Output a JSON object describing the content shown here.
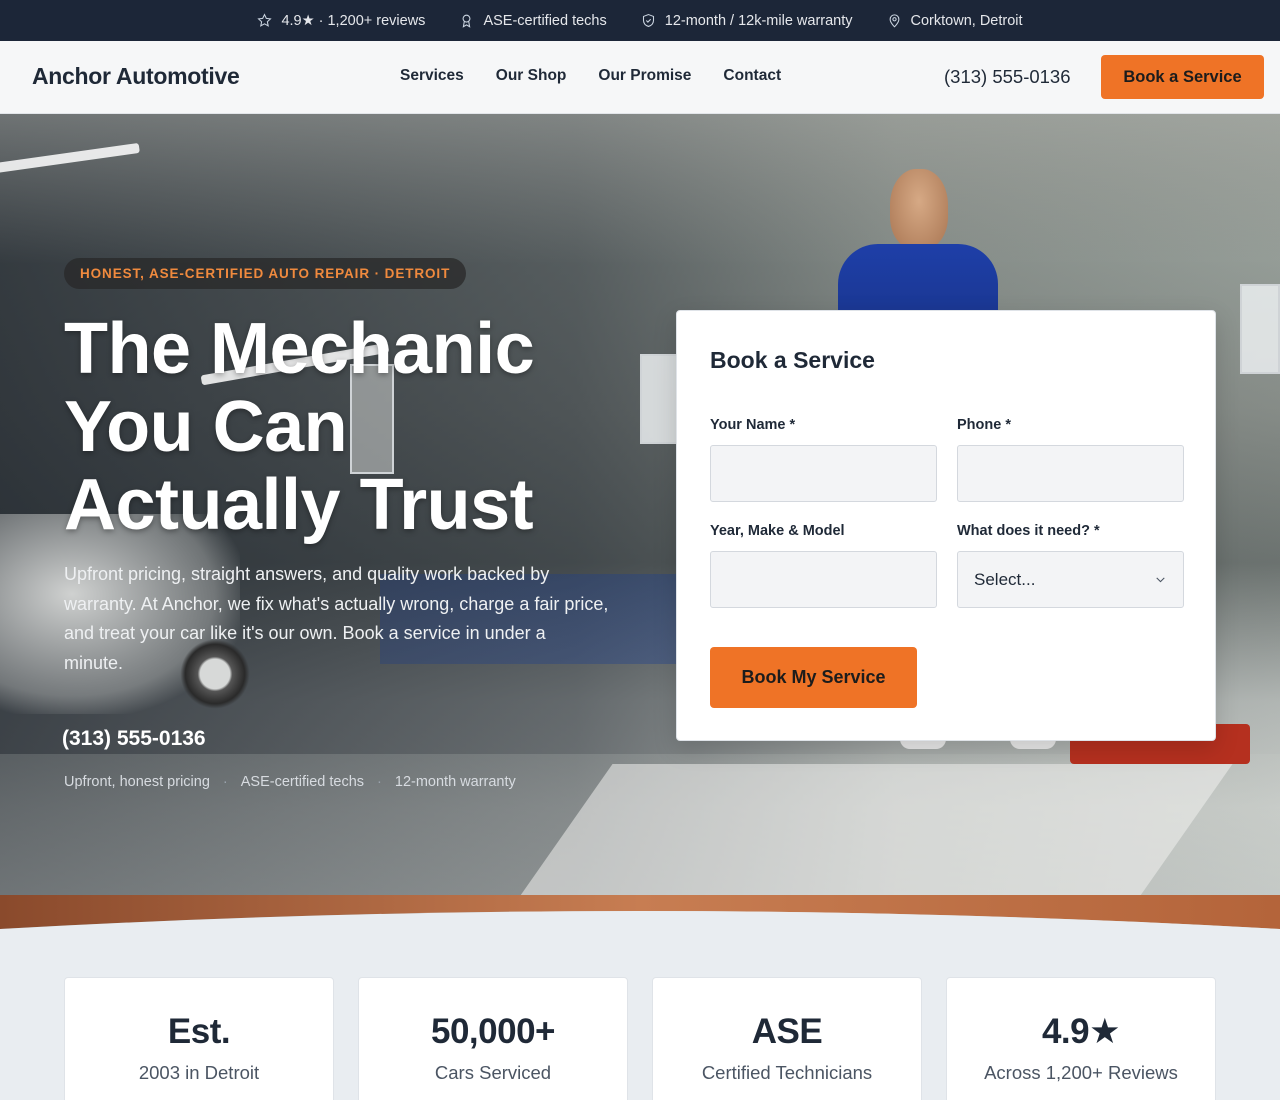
{
  "topbar": {
    "items": [
      {
        "icon": "star-icon",
        "text": "4.9★ · 1,200+ reviews"
      },
      {
        "icon": "award-icon",
        "text": "ASE-certified techs"
      },
      {
        "icon": "shield-icon",
        "text": "12-month / 12k-mile warranty"
      },
      {
        "icon": "map-pin-icon",
        "text": "Corktown, Detroit"
      }
    ]
  },
  "nav": {
    "brand": "Anchor Automotive",
    "links": [
      "Services",
      "Our Shop",
      "Our Promise",
      "Contact"
    ],
    "phone": "(313) 555-0136",
    "cta": "Book a Service"
  },
  "hero": {
    "badge": "HONEST, ASE-CERTIFIED AUTO REPAIR · DETROIT",
    "headline": "The Mechanic You Can Actually Trust",
    "lede": "Upfront pricing, straight answers, and quality work backed by warranty. At Anchor, we fix what's actually wrong, charge a fair price, and treat your car like it's our own. Book a service in under a minute.",
    "phone": "(313) 555-0136",
    "assurances": [
      "Upfront, honest pricing",
      "ASE-certified techs",
      "12-month warranty"
    ]
  },
  "form": {
    "title": "Book a Service",
    "name_label": "Your Name *",
    "name_value": "",
    "phone_label": "Phone *",
    "phone_value": "",
    "vehicle_label": "Year, Make & Model",
    "vehicle_value": "",
    "need_label": "What does it need? *",
    "need_selected": "Select...",
    "submit": "Book My Service"
  },
  "stats": [
    {
      "big": "Est.",
      "small": "2003 in Detroit"
    },
    {
      "big": "50,000+",
      "small": "Cars Serviced"
    },
    {
      "big": "ASE",
      "small": "Certified Technicians"
    },
    {
      "big": "4.9★",
      "small": "Across 1,200+ Reviews"
    }
  ],
  "colors": {
    "accent": "#ef7326",
    "topbar_bg": "#1c2638",
    "text_dark": "#1f2937",
    "curve": "#b4643a"
  }
}
